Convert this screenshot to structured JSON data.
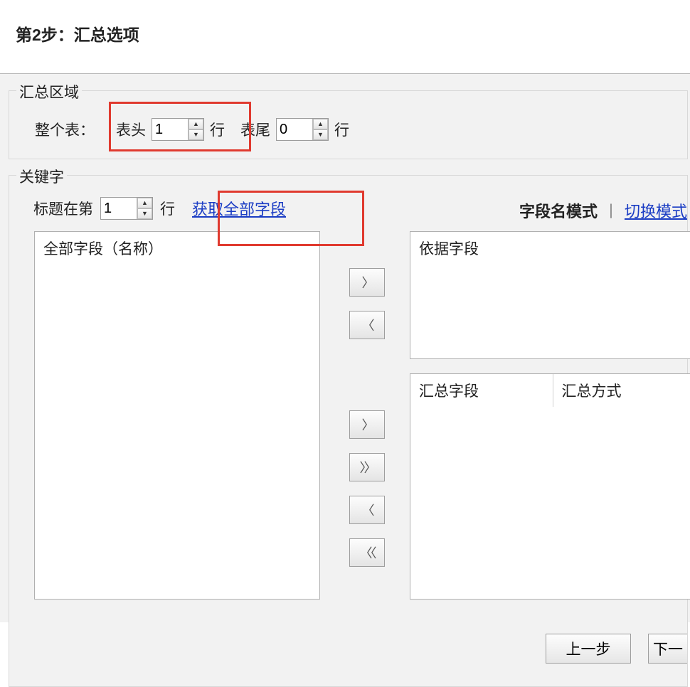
{
  "title": "第2步：汇总选项",
  "summary": {
    "legend": "汇总区域",
    "whole_table_label": "整个表：",
    "header_label": "表头",
    "header_value": "1",
    "rows_suffix": "行",
    "footer_label": "表尾",
    "footer_value": "0"
  },
  "keyword": {
    "legend": "关键字",
    "title_row_label": "标题在第",
    "title_row_value": "1",
    "rows_suffix": "行",
    "get_all_fields": "获取全部字段",
    "mode_label": "字段名模式",
    "switch_mode": "切换模式",
    "all_fields_header": "全部字段（名称）",
    "basis_fields_header": "依据字段",
    "sum_field_header": "汇总字段",
    "sum_mode_header": "汇总方式",
    "move_right": "〉",
    "move_left": "〈",
    "move_right2": "〉",
    "move_all_right": "〉〉",
    "move_left2": "〈",
    "move_all_left": "〈〈"
  },
  "footer": {
    "prev": "上一步",
    "next": "下一"
  }
}
